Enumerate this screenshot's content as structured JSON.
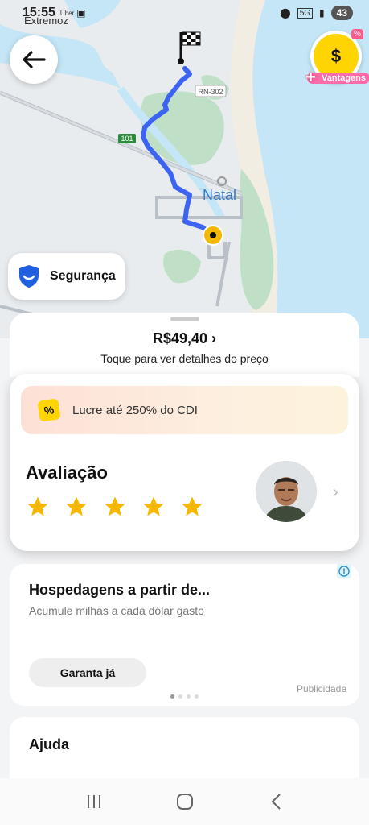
{
  "status_bar": {
    "time": "15:55",
    "app_label": "Uber",
    "battery": "43",
    "network": "5G"
  },
  "map": {
    "place_extremoz": "Extremoz",
    "place_natal": "Natal",
    "road_rn302": "RN-302",
    "road_101": "101"
  },
  "vantagens": {
    "label": "Vantagens",
    "symbol": "$",
    "badge": "%"
  },
  "seguranca": {
    "label": "Segurança"
  },
  "fare": {
    "price": "R$49,40",
    "chevron": "›",
    "hint": "Toque para ver detalhes do preço"
  },
  "promo": {
    "icon": "%",
    "text": "Lucre até 250% do CDI"
  },
  "rating": {
    "title": "Avaliação",
    "stars": 5
  },
  "ad": {
    "title": "Hospedagens a partir de...",
    "subtitle": "Acumule milhas a cada dólar gasto",
    "button": "Garanta já",
    "tag": "Publicidade"
  },
  "help": {
    "title": "Ajuda"
  },
  "colors": {
    "route": "#3d63f2",
    "star": "#f5b800",
    "brand_yellow": "#ffd400",
    "shield": "#1f5fe0"
  }
}
